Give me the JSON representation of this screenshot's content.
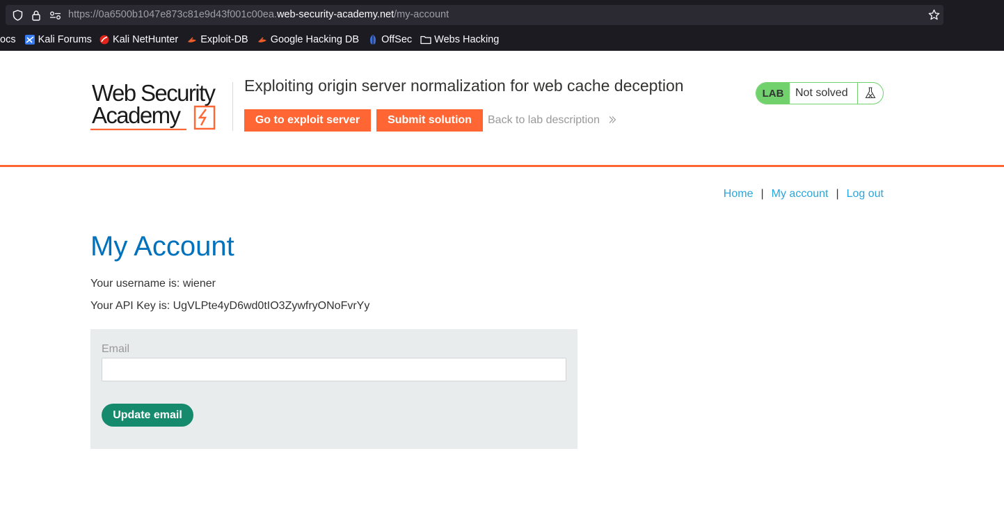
{
  "browser": {
    "url_prefix": "https://0a6500b1047e873c81e9d43f001c00ea.",
    "url_host": "web-security-academy.net",
    "url_path": "/my-account",
    "bookmarks": [
      {
        "label": "ocs",
        "icon": "none"
      },
      {
        "label": "Kali Forums",
        "icon": "kali-forums-icon"
      },
      {
        "label": "Kali NetHunter",
        "icon": "nethunter-icon"
      },
      {
        "label": "Exploit-DB",
        "icon": "exploit-db-icon"
      },
      {
        "label": "Google Hacking DB",
        "icon": "ghdb-icon"
      },
      {
        "label": "OffSec",
        "icon": "offsec-icon"
      },
      {
        "label": "Webs Hacking",
        "icon": "folder-icon"
      }
    ]
  },
  "header": {
    "logo_line1": "Web Security",
    "logo_line2": "Academy",
    "lab_title": "Exploiting origin server normalization for web cache deception",
    "exploit_button": "Go to exploit server",
    "submit_button": "Submit solution",
    "back_link": "Back to lab description",
    "status_tag": "LAB",
    "status_text": "Not solved"
  },
  "nav": {
    "home": "Home",
    "separator": "|",
    "my_account": "My account",
    "log_out": "Log out"
  },
  "main": {
    "title": "My Account",
    "username_line": "Your username is: wiener",
    "apikey_line": "Your API Key is: UgVLPte4yD6wd0tIO3ZywfryONoFvrYy",
    "email_label": "Email",
    "email_value": "",
    "update_button": "Update email"
  },
  "colors": {
    "accent_orange": "#ff6633",
    "heading_blue": "#0071bc",
    "link_blue": "#29a6db",
    "status_green": "#70d16d",
    "button_green": "#168a6c"
  }
}
